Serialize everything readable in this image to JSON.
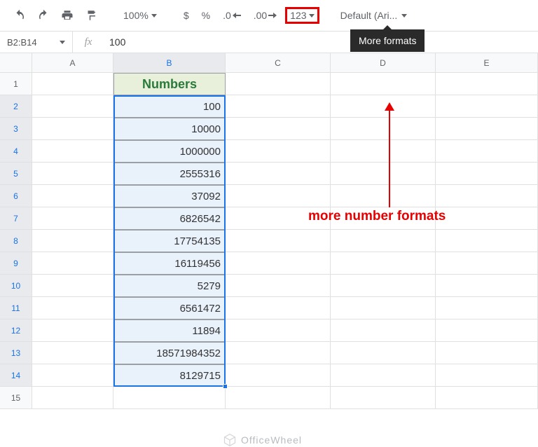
{
  "toolbar": {
    "zoom": "100%",
    "currency": "$",
    "percent": "%",
    "dec_dec": ".0",
    "dec_inc": ".00",
    "more_formats": "123",
    "font": "Default (Ari...",
    "tooltip": "More formats"
  },
  "formula_bar": {
    "name_box": "B2:B14",
    "fx": "fx",
    "value": "100"
  },
  "columns": [
    "A",
    "B",
    "C",
    "D",
    "E"
  ],
  "rows": [
    "1",
    "2",
    "3",
    "4",
    "5",
    "6",
    "7",
    "8",
    "9",
    "10",
    "11",
    "12",
    "13",
    "14",
    "15"
  ],
  "header_label": "Numbers",
  "data": [
    "100",
    "10000",
    "1000000",
    "2555316",
    "37092",
    "6826542",
    "17754135",
    "16119456",
    "5279",
    "6561472",
    "11894",
    "18571984352",
    "8129715"
  ],
  "annotation": "more number formats",
  "watermark": "OfficeWheel"
}
